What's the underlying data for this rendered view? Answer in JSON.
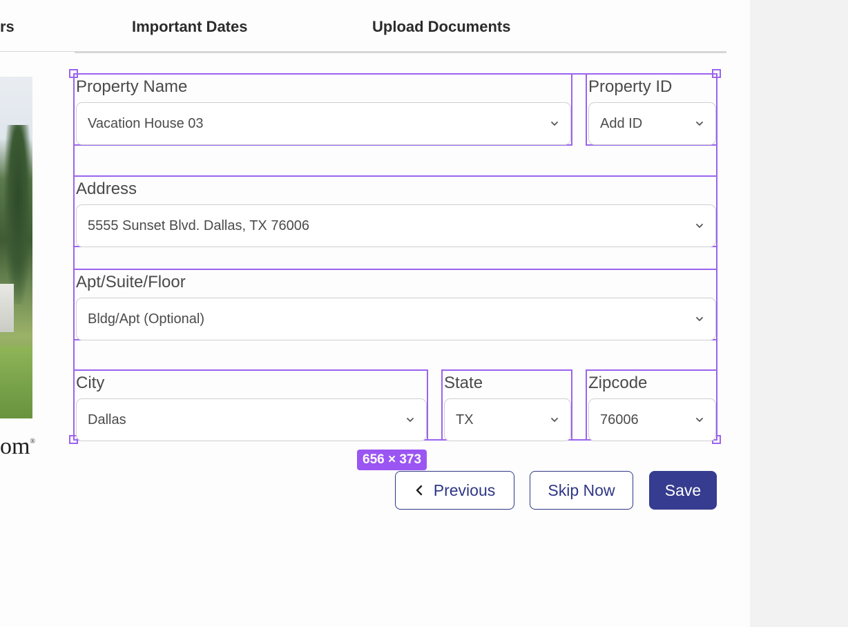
{
  "tabs": {
    "partial_left": "rs",
    "important_dates": "Important Dates",
    "upload_documents": "Upload Documents"
  },
  "left_panel": {
    "logo_fragment": "om",
    "logo_mark": "®"
  },
  "selection": {
    "size_label": "656 × 373"
  },
  "form": {
    "property_name": {
      "label": "Property Name",
      "value": "Vacation House 03"
    },
    "property_id": {
      "label": "Property ID",
      "value": "Add ID"
    },
    "address": {
      "label": "Address",
      "value": "5555 Sunset Blvd. Dallas, TX 76006"
    },
    "apt_suite_floor": {
      "label": "Apt/Suite/Floor",
      "value": "Bldg/Apt (Optional)"
    },
    "city": {
      "label": "City",
      "value": "Dallas"
    },
    "state": {
      "label": "State",
      "value": "TX"
    },
    "zipcode": {
      "label": "Zipcode",
      "value": "76006"
    }
  },
  "actions": {
    "previous": "Previous",
    "skip_now": "Skip Now",
    "save": "Save"
  },
  "colors": {
    "selection": "#9a63f0",
    "primary": "#363c8f",
    "badge": "#9a55f2"
  },
  "icons": {
    "select_chevron": "chevron-down-icon",
    "previous": "chevron-left-icon"
  }
}
